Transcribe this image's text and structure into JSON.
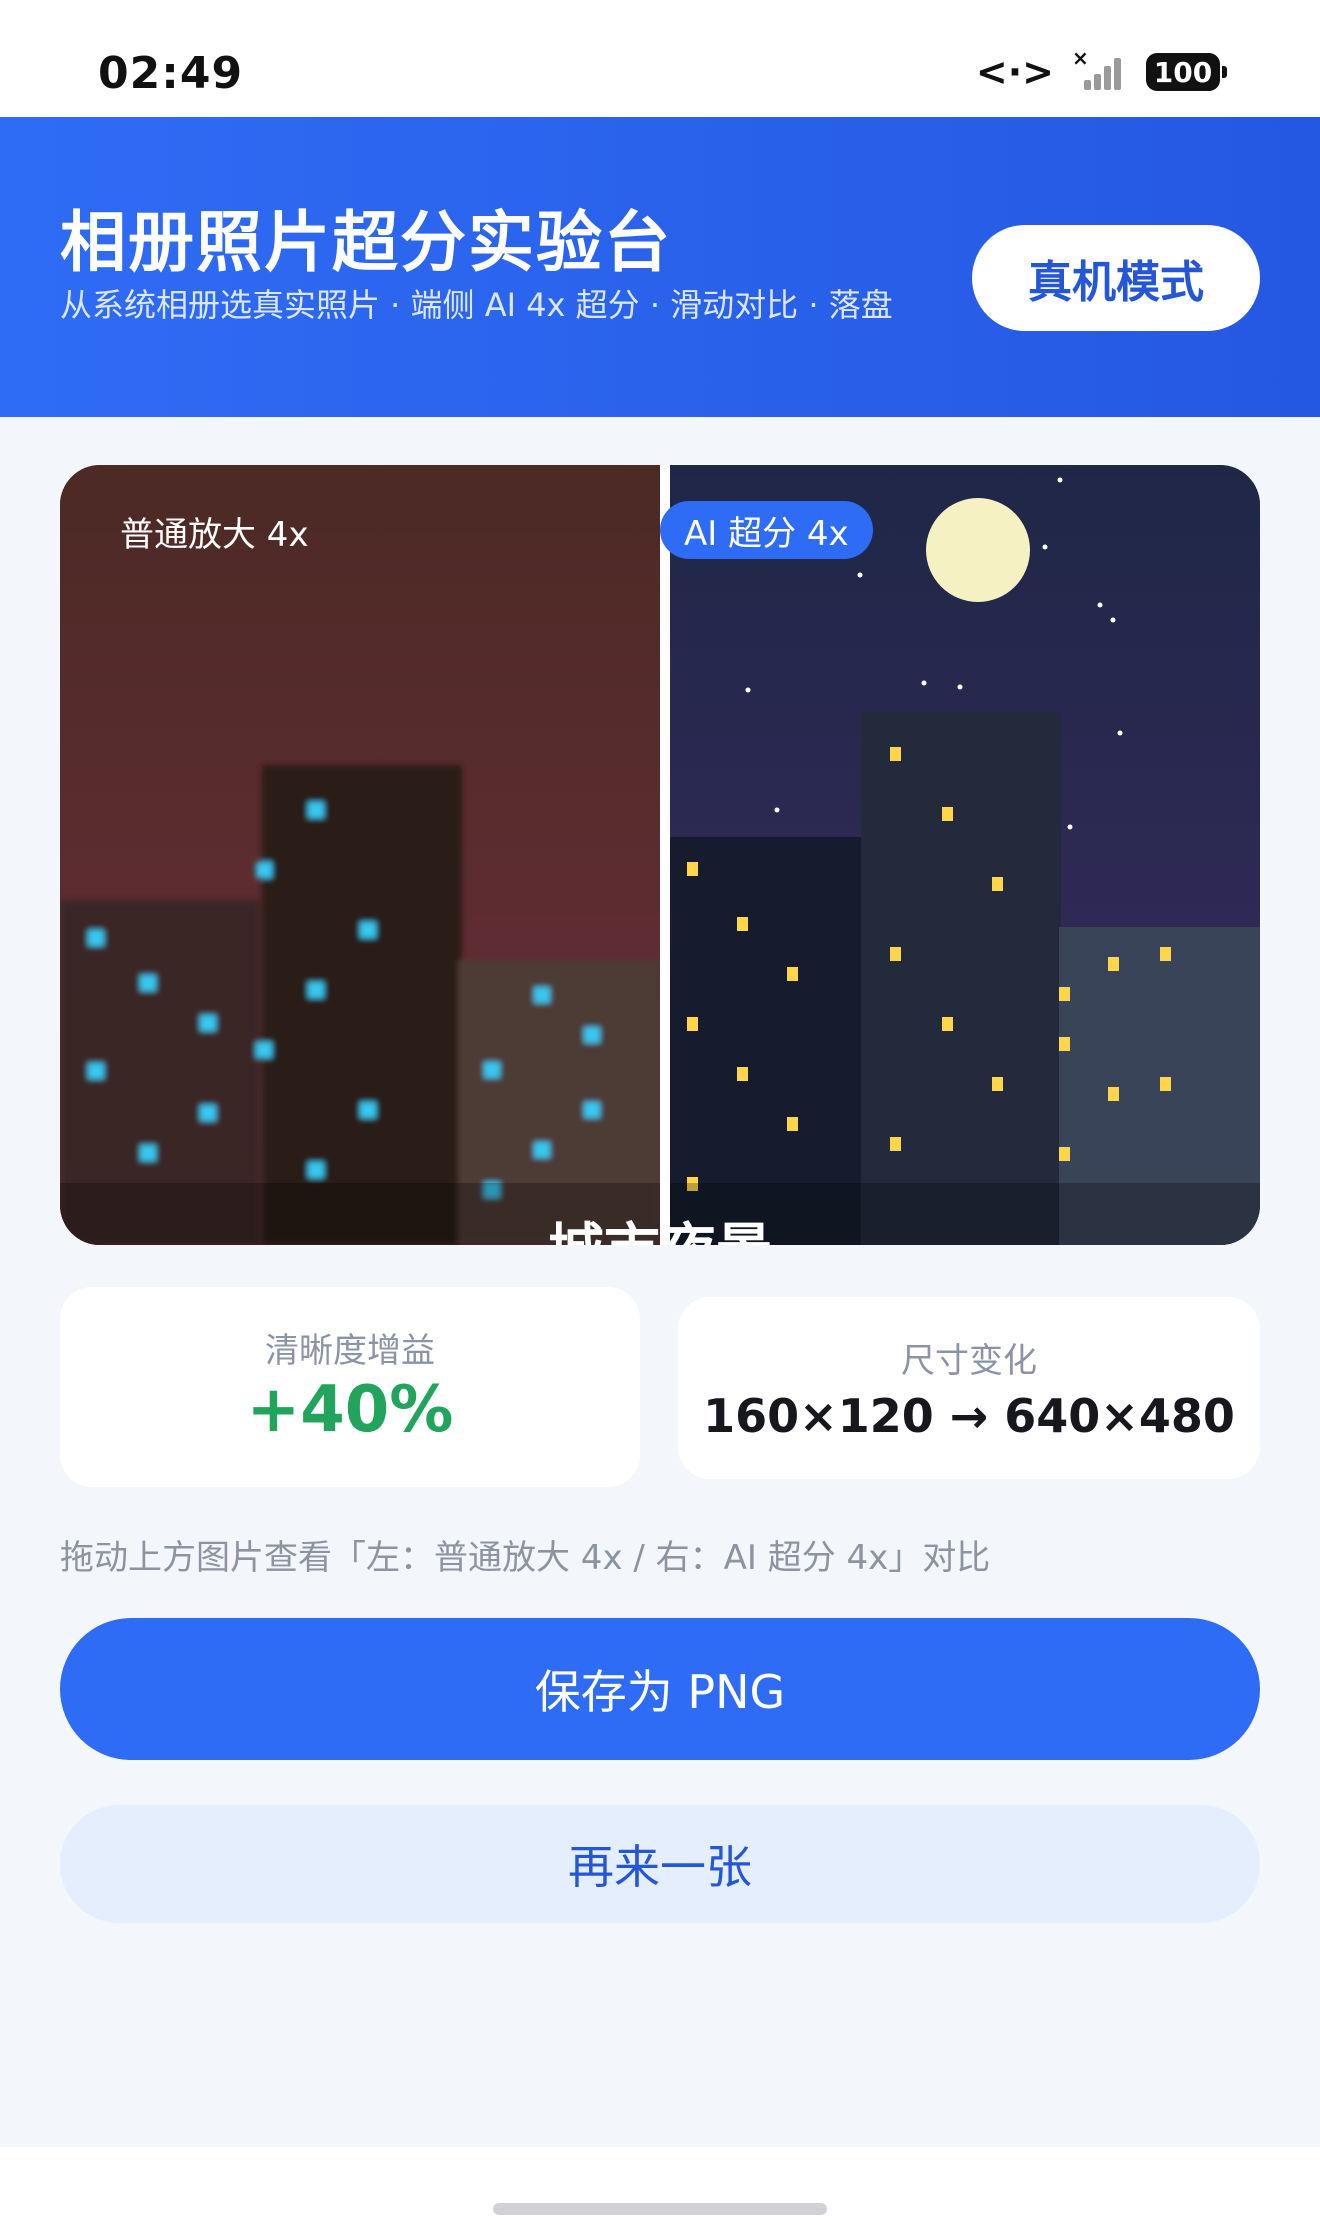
{
  "status_bar": {
    "time": "02:49",
    "network_icon": "data-transfer-icon",
    "signal_icon": "signal-no-service-icon",
    "battery": "100"
  },
  "header": {
    "title": "相册照片超分实验台",
    "subtitle": "从系统相册选真实照片 · 端侧 AI 4x 超分 · 滑动对比 · 落盘",
    "mode_button": "真机模式"
  },
  "comparison": {
    "left_label": "普通放大 4x",
    "right_label": "AI 超分 4x",
    "caption": "城市夜景",
    "colors": {
      "left_sky_top": "#4c2a25",
      "left_sky_bottom": "#6a2e3a",
      "right_sky_top": "#1f2747",
      "right_sky_bottom": "#3a2b5f",
      "left_window": "#38c7ee",
      "right_window": "#ffd54a",
      "moon": "#f5f1c2",
      "divider": "#ffffff",
      "label_badge": "#2f6cf5"
    }
  },
  "stats": {
    "gain_label": "清晰度增益",
    "gain_value": "+40%",
    "size_label": "尺寸变化",
    "size_value": "160×120 → 640×480"
  },
  "hint": "拖动上方图片查看「左：普通放大 4x / 右：AI 超分 4x」对比",
  "actions": {
    "save_label": "保存为 PNG",
    "retry_label": "再来一张"
  },
  "colors": {
    "accent": "#2f6cf5",
    "gain": "#22a45d",
    "background": "#f3f6fb"
  }
}
